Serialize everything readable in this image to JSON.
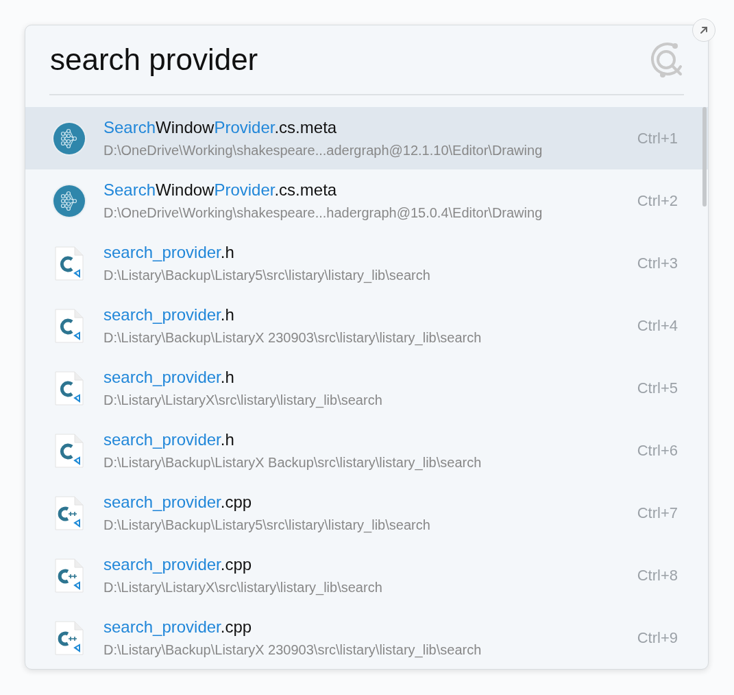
{
  "search": {
    "value": "search provider"
  },
  "results": [
    {
      "kind": "neural",
      "selected": true,
      "name": [
        {
          "text": "Search",
          "match": true
        },
        {
          "text": "Window",
          "match": false
        },
        {
          "text": "Provider",
          "match": true
        },
        {
          "text": ".cs.meta",
          "match": false
        }
      ],
      "path": "D:\\OneDrive\\Working\\shakespeare...adergraph@12.1.10\\Editor\\Drawing",
      "shortcut": "Ctrl+1"
    },
    {
      "kind": "neural",
      "selected": false,
      "name": [
        {
          "text": "Search",
          "match": true
        },
        {
          "text": "Window",
          "match": false
        },
        {
          "text": "Provider",
          "match": true
        },
        {
          "text": ".cs.meta",
          "match": false
        }
      ],
      "path": "D:\\OneDrive\\Working\\shakespeare...hadergraph@15.0.4\\Editor\\Drawing",
      "shortcut": "Ctrl+2"
    },
    {
      "kind": "c",
      "selected": false,
      "name": [
        {
          "text": "search_provider",
          "match": true
        },
        {
          "text": ".h",
          "match": false
        }
      ],
      "path": "D:\\Listary\\Backup\\Listary5\\src\\listary\\listary_lib\\search",
      "shortcut": "Ctrl+3"
    },
    {
      "kind": "c",
      "selected": false,
      "name": [
        {
          "text": "search_provider",
          "match": true
        },
        {
          "text": ".h",
          "match": false
        }
      ],
      "path": "D:\\Listary\\Backup\\ListaryX 230903\\src\\listary\\listary_lib\\search",
      "shortcut": "Ctrl+4"
    },
    {
      "kind": "c",
      "selected": false,
      "name": [
        {
          "text": "search_provider",
          "match": true
        },
        {
          "text": ".h",
          "match": false
        }
      ],
      "path": "D:\\Listary\\ListaryX\\src\\listary\\listary_lib\\search",
      "shortcut": "Ctrl+5"
    },
    {
      "kind": "c",
      "selected": false,
      "name": [
        {
          "text": "search_provider",
          "match": true
        },
        {
          "text": ".h",
          "match": false
        }
      ],
      "path": "D:\\Listary\\Backup\\ListaryX Backup\\src\\listary\\listary_lib\\search",
      "shortcut": "Ctrl+6"
    },
    {
      "kind": "cpp",
      "selected": false,
      "name": [
        {
          "text": "search_provider",
          "match": true
        },
        {
          "text": ".cpp",
          "match": false
        }
      ],
      "path": "D:\\Listary\\Backup\\Listary5\\src\\listary\\listary_lib\\search",
      "shortcut": "Ctrl+7"
    },
    {
      "kind": "cpp",
      "selected": false,
      "name": [
        {
          "text": "search_provider",
          "match": true
        },
        {
          "text": ".cpp",
          "match": false
        }
      ],
      "path": "D:\\Listary\\ListaryX\\src\\listary\\listary_lib\\search",
      "shortcut": "Ctrl+8"
    },
    {
      "kind": "cpp",
      "selected": false,
      "name": [
        {
          "text": "search_provider",
          "match": true
        },
        {
          "text": ".cpp",
          "match": false
        }
      ],
      "path": "D:\\Listary\\Backup\\ListaryX 230903\\src\\listary\\listary_lib\\search",
      "shortcut": "Ctrl+9"
    }
  ]
}
